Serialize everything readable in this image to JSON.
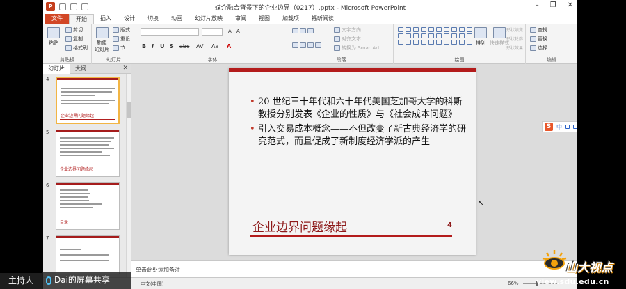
{
  "window": {
    "title": "媒介融合背景下的企业边界（0217）.pptx - Microsoft PowerPoint",
    "min": "–",
    "restore": "❐",
    "close": "✕"
  },
  "ribbon_tabs": [
    "文件",
    "开始",
    "插入",
    "设计",
    "切换",
    "动画",
    "幻灯片放映",
    "审阅",
    "视图",
    "加载项",
    "福昕阅读"
  ],
  "ribbon": {
    "clipboard": {
      "paste": "粘贴",
      "cut": "剪切",
      "copy": "复制",
      "format_painter": "格式刷",
      "label": "剪贴板"
    },
    "slides": {
      "new_slide": "新建",
      "new_slide_line2": "幻灯片",
      "layout": "版式",
      "reset": "重设",
      "section": "节",
      "label": "幻灯片"
    },
    "font": {
      "label": "字体",
      "bold": "B",
      "italic": "I",
      "underline": "U",
      "shadow": "S",
      "strike": "abc",
      "spacing": "AV",
      "case": "Aa",
      "color": "A"
    },
    "paragraph": {
      "text_direction": "文字方向",
      "align_text": "对齐文本",
      "smartart": "转换为 SmartArt",
      "label": "段落"
    },
    "drawing": {
      "arrange": "排列",
      "quick_styles": "快速样式",
      "shape_fill": "形状填充",
      "shape_outline": "形状轮廓",
      "shape_effects": "形状效果",
      "label": "绘图"
    },
    "editing": {
      "find": "查找",
      "replace": "替换",
      "select": "选择",
      "label": "编辑"
    }
  },
  "panel": {
    "tab_slides": "幻灯片",
    "tab_outline": "大纲",
    "close": "✕",
    "thumbnails": [
      {
        "num": "4",
        "caption": "企业边界问题缘起",
        "selected": true
      },
      {
        "num": "5",
        "caption": "企业边界问题缘起",
        "selected": false
      },
      {
        "num": "6",
        "caption": "目录",
        "selected": false
      },
      {
        "num": "7",
        "caption": "",
        "selected": false
      }
    ]
  },
  "slide": {
    "bullets": [
      "20 世纪三十年代和六十年代美国芝加哥大学的科斯教授分别发表《企业的性质》与《社会成本问题》",
      "引入交易成本概念——不但改变了新古典经济学的研究范式，而且促成了新制度经济学派的产生"
    ],
    "title": "企业边界问题缘起",
    "number": "4"
  },
  "ime": {
    "s": "S",
    "mode": "中"
  },
  "notes": {
    "placeholder": "单击此处添加备注"
  },
  "status": {
    "language": "中文(中国)",
    "zoom": "66%"
  },
  "overlay": {
    "host": "主持人",
    "share": "Dai的屏幕共享",
    "brand": "山大视点",
    "url": "view.sdu.edu.cn"
  },
  "colors": {
    "accent_red": "#b31b1b",
    "file_tab": "#d24726"
  }
}
